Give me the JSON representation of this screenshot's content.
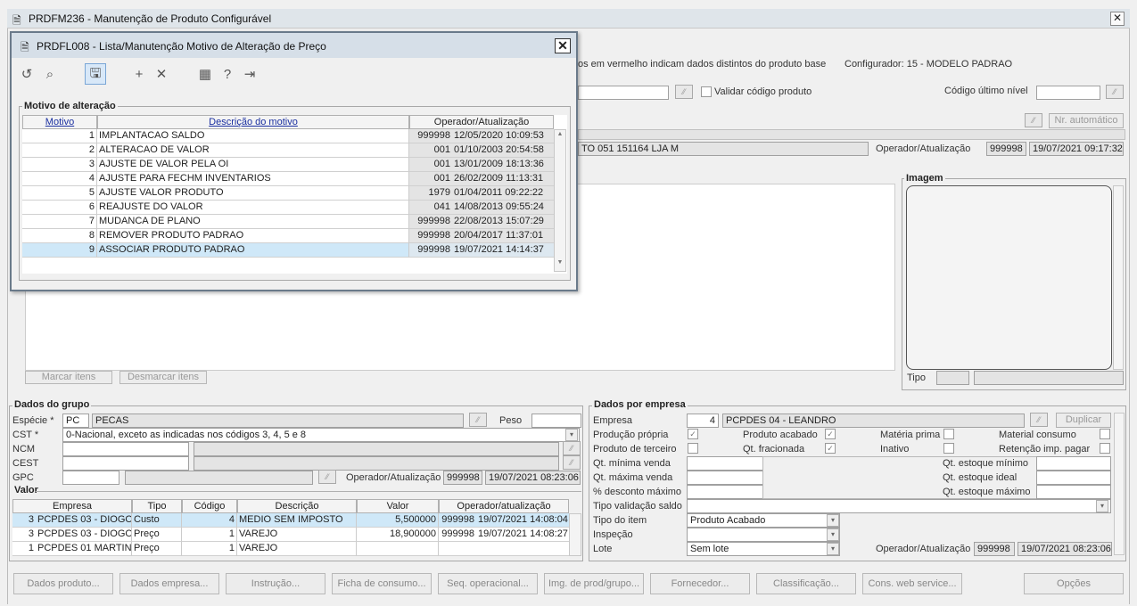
{
  "main_window": {
    "title": "PRDFM236 - Manutenção de Produto Configurável",
    "close": "✕",
    "info_text": "os em vermelho indicam dados distintos do produto base",
    "configurador": "Configurador: 15 - MODELO PADRAO",
    "validar_label": "Validar código produto",
    "codigo_ultimo_nivel_label": "Código último nível",
    "nr_automatico_label": "Nr. automático",
    "product_desc": "TO 051 151164 LJA M",
    "operador_label": "Operador/Atualização",
    "operador_code": "999998",
    "operador_date": "19/07/2021 09:17:32",
    "imagem_title": "Imagem",
    "tipo_label": "Tipo",
    "marcar_label": "Marcar itens",
    "desmarcar_label": "Desmarcar itens"
  },
  "dialog": {
    "title": "PRDFL008 - Lista/Manutenção Motivo de Alteração de Preço",
    "close": "✕",
    "group_title": "Motivo de alteração",
    "columns": [
      "Motivo",
      "Descrição do motivo",
      "Operador/Atualização"
    ],
    "rows": [
      {
        "motivo": "1",
        "descricao": "IMPLANTACAO SALDO",
        "operador": "999998",
        "data": "12/05/2020 10:09:53"
      },
      {
        "motivo": "2",
        "descricao": "ALTERACAO DE VALOR",
        "operador": "001",
        "data": "01/10/2003 20:54:58"
      },
      {
        "motivo": "3",
        "descricao": "AJUSTE DE VALOR PELA OI",
        "operador": "001",
        "data": "13/01/2009 18:13:36"
      },
      {
        "motivo": "4",
        "descricao": "AJUSTE PARA FECHM INVENTARIOS",
        "operador": "001",
        "data": "26/02/2009 11:13:31"
      },
      {
        "motivo": "5",
        "descricao": "AJUSTE VALOR PRODUTO",
        "operador": "1979",
        "data": "01/04/2011 09:22:22"
      },
      {
        "motivo": "6",
        "descricao": "REAJUSTE DO VALOR",
        "operador": "041",
        "data": "14/08/2013 09:55:24"
      },
      {
        "motivo": "7",
        "descricao": "MUDANCA DE PLANO",
        "operador": "999998",
        "data": "22/08/2013 15:07:29"
      },
      {
        "motivo": "8",
        "descricao": "REMOVER PRODUTO PADRAO",
        "operador": "999998",
        "data": "20/04/2017 11:37:01"
      },
      {
        "motivo": "9",
        "descricao": "ASSOCIAR PRODUTO PADRAO",
        "operador": "999998",
        "data": "19/07/2021 14:14:37"
      }
    ]
  },
  "dados_grupo": {
    "title": "Dados do grupo",
    "especie_label": "Espécie *",
    "especie_code": "PC",
    "especie_desc": "PECAS",
    "peso_label": "Peso",
    "cst_label": "CST *",
    "cst_value": "0-Nacional, exceto as indicadas nos códigos 3, 4, 5 e 8",
    "ncm_label": "NCM",
    "cest_label": "CEST",
    "gpc_label": "GPC",
    "operador_label": "Operador/Atualização",
    "operador_code": "999998",
    "operador_date": "19/07/2021 08:23:06"
  },
  "valor": {
    "title": "Valor",
    "columns": [
      "Empresa",
      "Tipo",
      "Código",
      "Descrição",
      "Valor",
      "Operador/atualização"
    ],
    "rows": [
      {
        "emp_code": "3",
        "emp_name": "PCPDES 03 - DIOGO",
        "tipo": "Custo",
        "codigo": "4",
        "descricao": "MEDIO SEM IMPOSTO",
        "valor": "5,500000",
        "operador": "999998",
        "data": "19/07/2021 14:08:04"
      },
      {
        "emp_code": "3",
        "emp_name": "PCPDES 03 - DIOGO",
        "tipo": "Preço",
        "codigo": "1",
        "descricao": "VAREJO",
        "valor": "18,900000",
        "operador": "999998",
        "data": "19/07/2021 14:08:27"
      },
      {
        "emp_code": "1",
        "emp_name": "PCPDES 01 MARTINS",
        "tipo": "Preço",
        "codigo": "1",
        "descricao": "VAREJO",
        "valor": "",
        "operador": "",
        "data": ""
      }
    ]
  },
  "dados_empresa": {
    "title": "Dados por empresa",
    "empresa_label": "Empresa",
    "empresa_code": "4",
    "empresa_name": "PCPDES 04 - LEANDRO",
    "duplicar_label": "Duplicar",
    "producao_propria": "Produção própria",
    "produto_acabado": "Produto acabado",
    "materia_prima": "Matéria prima",
    "material_consumo": "Material consumo",
    "produto_terceiro": "Produto de terceiro",
    "qt_fracionada": "Qt. fracionada",
    "inativo": "Inativo",
    "retencao": "Retenção imp. pagar",
    "qt_min_venda": "Qt. mínima venda",
    "qt_max_venda": "Qt. máxima venda",
    "desconto_max": "% desconto máximo",
    "qt_est_min": "Qt. estoque mínimo",
    "qt_est_ideal": "Qt. estoque ideal",
    "qt_est_max": "Qt. estoque máximo",
    "tipo_validacao": "Tipo validação saldo",
    "tipo_item_label": "Tipo do item",
    "tipo_item_value": "Produto Acabado",
    "inspecao_label": "Inspeção",
    "lote_label": "Lote",
    "lote_value": "Sem lote",
    "operador_label": "Operador/Atualização",
    "operador_code": "999998",
    "operador_date": "19/07/2021 08:23:06"
  },
  "bottom_buttons": [
    "Dados produto...",
    "Dados empresa...",
    "Instrução...",
    "Ficha de consumo...",
    "Seq. operacional...",
    "Img. de prod/grupo...",
    "Fornecedor...",
    "Classificação...",
    "Cons. web service...",
    "Opções"
  ]
}
